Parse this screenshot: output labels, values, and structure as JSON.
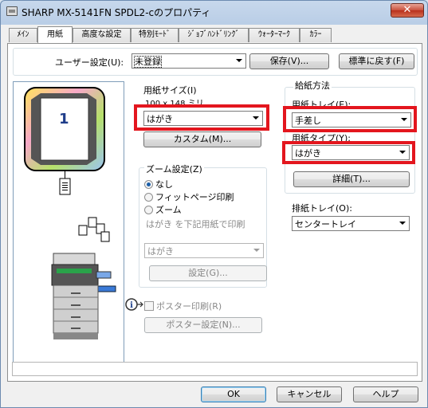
{
  "window": {
    "title": "SHARP MX-5141FN SPDL2-cのプロパティ",
    "close_label": "✕"
  },
  "tabs": [
    {
      "label": "ﾒｲﾝ",
      "active": false
    },
    {
      "label": "用紙",
      "active": true
    },
    {
      "label": "高度な設定",
      "active": false
    },
    {
      "label": "特別ﾓｰﾄﾞ",
      "active": false
    },
    {
      "label": "ｼﾞｮﾌﾞﾊﾝﾄﾞﾘﾝｸﾞ",
      "active": false
    },
    {
      "label": "ｳｫｰﾀｰﾏｰｸ",
      "active": false
    },
    {
      "label": "ｶﾗｰ",
      "active": false
    }
  ],
  "user_settings": {
    "label": "ユーザー設定(U):",
    "value": "未登録",
    "save_label": "保存(V)...",
    "default_label": "標準に戻す(F)"
  },
  "preview": {
    "page_number": "1"
  },
  "paper_size": {
    "title": "用紙サイズ(I)",
    "dimension": "100 x 148 ミリ",
    "value": "はがき",
    "custom_label": "カスタム(M)..."
  },
  "zoom": {
    "title": "ズーム設定(Z)",
    "options": [
      {
        "label": "なし",
        "selected": true
      },
      {
        "label": "フィットページ印刷",
        "selected": false
      },
      {
        "label": "ズーム",
        "selected": false
      }
    ],
    "hint": "はがき を下記用紙で印刷",
    "target_value": "はがき",
    "settings_label": "設定(G)..."
  },
  "poster": {
    "checkbox_label": "ポスター印刷(R)",
    "settings_label": "ポスター設定(N)..."
  },
  "feed": {
    "title": "給紙方法",
    "tray_label": "用紙トレイ(E):",
    "tray_value": "手差し",
    "type_label": "用紙タイプ(Y):",
    "type_value": "はがき",
    "detail_label": "詳細(T)..."
  },
  "output": {
    "label": "排紙トレイ(O):",
    "value": "センタートレイ"
  },
  "footer": {
    "ok": "OK",
    "cancel": "キャンセル",
    "help": "ヘルプ"
  },
  "colors": {
    "highlight_border": "#e3161e",
    "page_number": "#1f3d8a"
  }
}
